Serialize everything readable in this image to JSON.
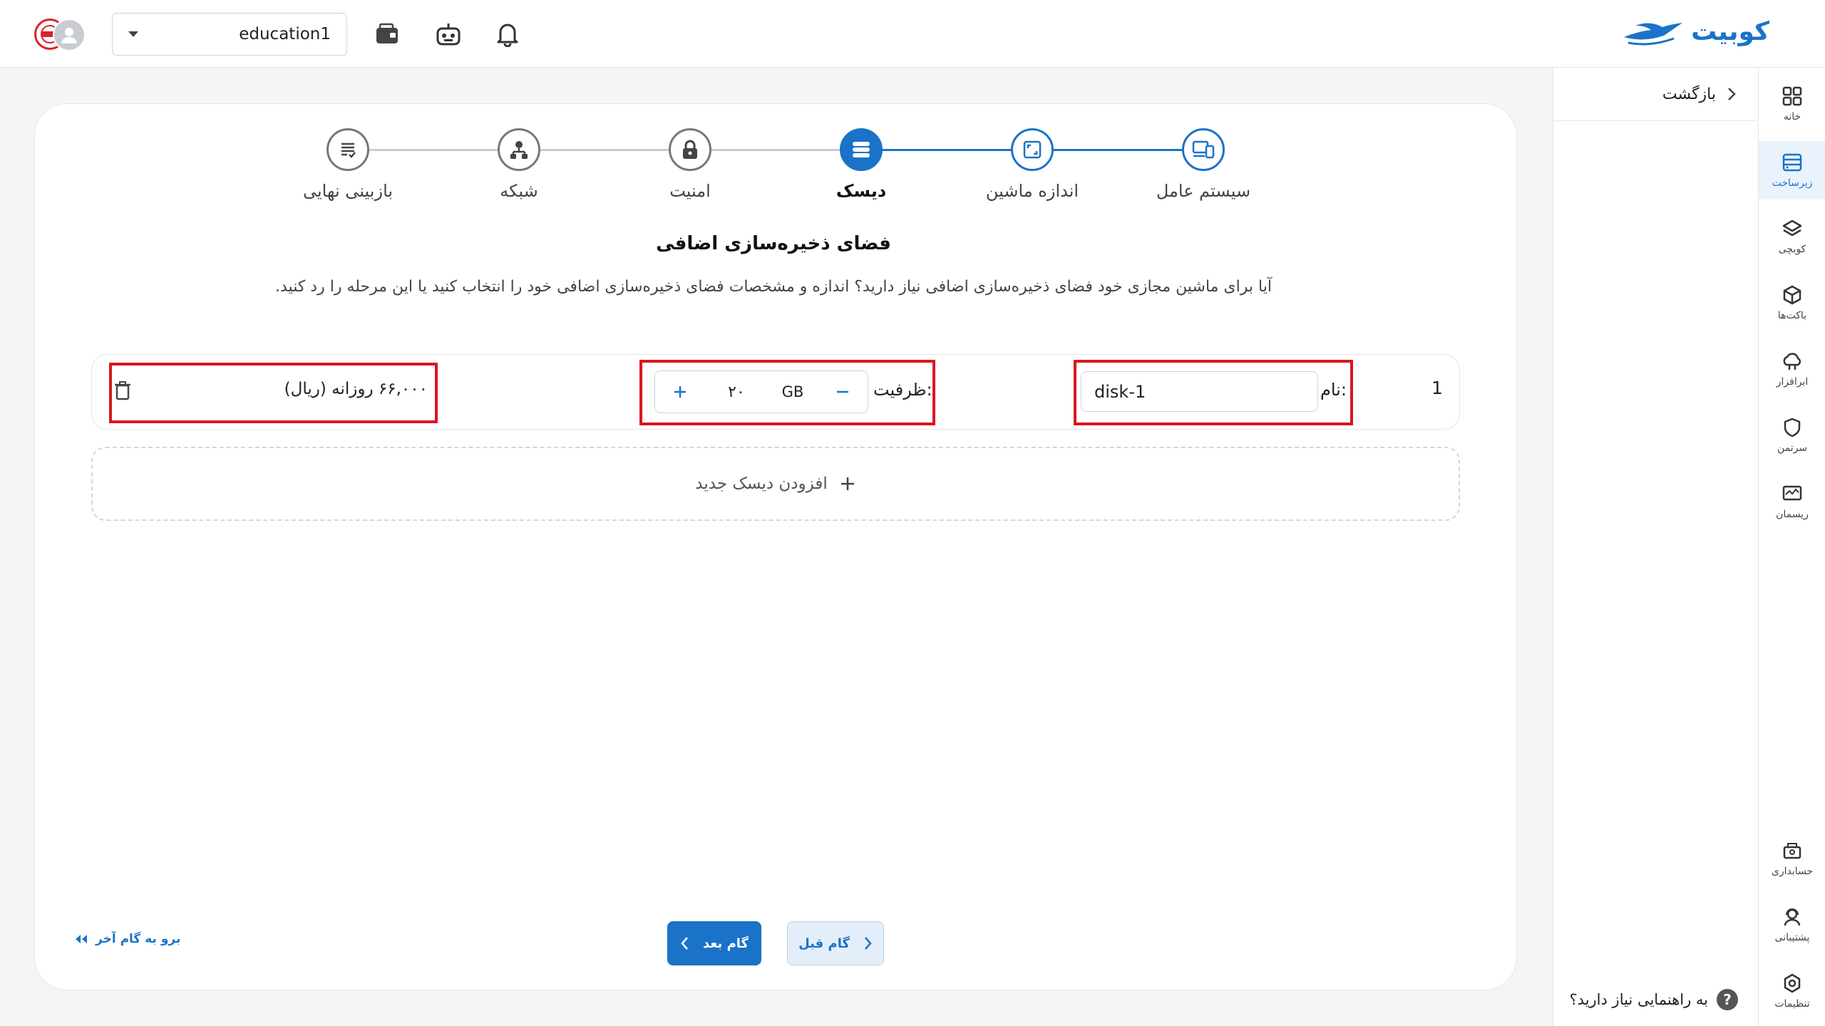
{
  "brand": {
    "name": "کوبیت"
  },
  "topbar": {
    "project": "education1",
    "icons": [
      "wallet-icon",
      "robot-icon",
      "bell-icon"
    ]
  },
  "rail": {
    "items": [
      {
        "label": "خانه",
        "icon": "grid-icon"
      },
      {
        "label": "زیرساخت",
        "icon": "server-icon"
      },
      {
        "label": "کوبچی",
        "icon": "layers-icon"
      },
      {
        "label": "باکت‌ها",
        "icon": "cube-icon"
      },
      {
        "label": "ابرافزار",
        "icon": "cloud-icon"
      },
      {
        "label": "سرتمن",
        "icon": "shield-icon"
      },
      {
        "label": "ریسمان",
        "icon": "monitor-icon"
      },
      {
        "label": "حسابداری",
        "icon": "cash-icon"
      },
      {
        "label": "پشتیبانی",
        "icon": "headset-icon"
      },
      {
        "label": "تنظیمات",
        "icon": "settings-icon"
      }
    ],
    "active_index": 1
  },
  "subpanel": {
    "back": "بازگشت",
    "help": "به راهنمایی نیاز دارید؟"
  },
  "steps": [
    {
      "label": "سیستم عامل",
      "state": "done"
    },
    {
      "label": "اندازه ماشین",
      "state": "done"
    },
    {
      "label": "دیسک",
      "state": "current"
    },
    {
      "label": "امنیت",
      "state": "todo"
    },
    {
      "label": "شبکه",
      "state": "todo"
    },
    {
      "label": "بازبینی نهایی",
      "state": "todo"
    }
  ],
  "section": {
    "title": "فضای ذخیره‌سازی اضافی",
    "description": "آیا برای ماشین مجازی خود فضای ذخیره‌سازی اضافی نیاز دارید؟ اندازه و مشخصات فضای ذخیره‌سازی اضافی خود را انتخاب کنید یا این مرحله را رد کنید."
  },
  "disk": {
    "index": "1",
    "name_label": "نام:",
    "name_value": "disk-1",
    "capacity_label": "ظرفیت:",
    "capacity_value": "۲۰",
    "capacity_unit": "GB",
    "price": "۶۶,۰۰۰ روزانه (ریال)"
  },
  "add_disk": "افزودن دیسک جدید",
  "nav": {
    "next": "گام بعد",
    "prev": "گام قبل",
    "go_last": "برو به گام آخر"
  },
  "colors": {
    "accent": "#1a73c8",
    "highlight": "#d9171f"
  }
}
